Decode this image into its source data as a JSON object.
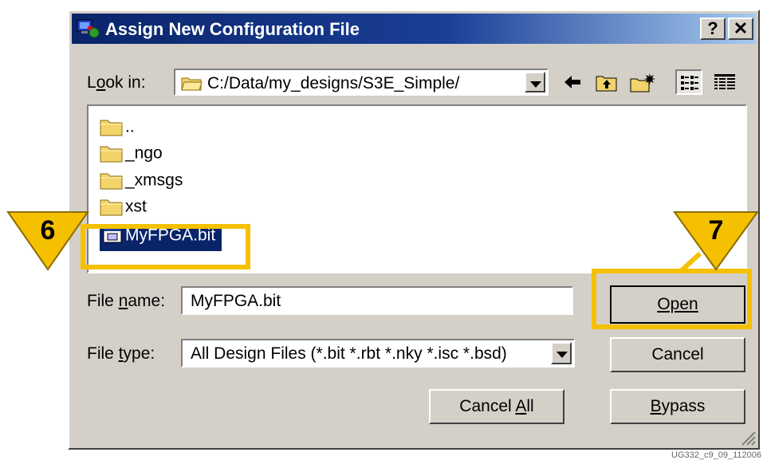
{
  "dialog": {
    "title": "Assign New Configuration File",
    "help_label": "?",
    "close_label": "✕",
    "look_in_label": "Look in:",
    "look_in_path": "C:/Data/my_designs/S3E_Simple/",
    "files": [
      {
        "name": "..",
        "type": "folder"
      },
      {
        "name": "_ngo",
        "type": "folder"
      },
      {
        "name": "_xmsgs",
        "type": "folder"
      },
      {
        "name": "xst",
        "type": "folder"
      },
      {
        "name": "MyFPGA.bit",
        "type": "file",
        "selected": true
      }
    ],
    "file_name_label": "File name:",
    "file_name_value": "MyFPGA.bit",
    "file_type_label": "File type:",
    "file_type_value": "All Design Files (*.bit *.rbt *.nky *.isc *.bsd)",
    "buttons": {
      "open": "Open",
      "cancel": "Cancel",
      "cancel_all": "Cancel All",
      "bypass": "Bypass"
    }
  },
  "callouts": {
    "step6": "6",
    "step7": "7",
    "color": "#f5c000"
  },
  "watermark": "UG332_c9_09_112006",
  "toolbar_icons": [
    "back-arrow-icon",
    "up-folder-icon",
    "new-folder-icon",
    "list-view-icon",
    "details-view-icon"
  ]
}
